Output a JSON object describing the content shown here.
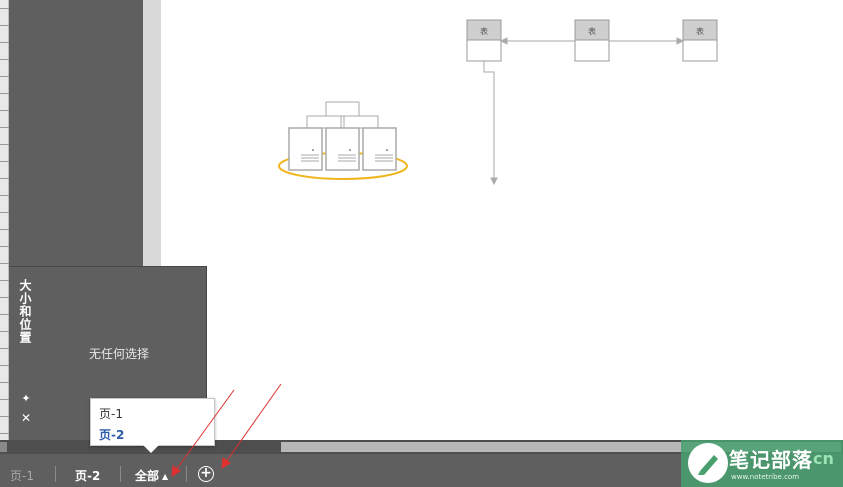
{
  "canvas": {
    "table_label": "表",
    "server_group_highlight": "#f0b51e"
  },
  "size_panel": {
    "title": "大小和位置",
    "empty_message": "无任何选择",
    "pin_icon": "pin-icon",
    "close_icon": "close-icon"
  },
  "page_popup": {
    "items": [
      "页-1",
      "页-2"
    ],
    "selected": "页-2"
  },
  "tabs": {
    "page1": "页-1",
    "page2": "页-2",
    "all": "全部",
    "all_caret": "▲",
    "add_icon": "⊕"
  },
  "watermark": {
    "main": "笔记部落",
    "suffix": "cn",
    "url": "www.notetribe.com"
  },
  "colors": {
    "annotation_arrow": "#e03030",
    "selected_page": "#2e5aa8",
    "watermark_bg": "#48a06e"
  }
}
